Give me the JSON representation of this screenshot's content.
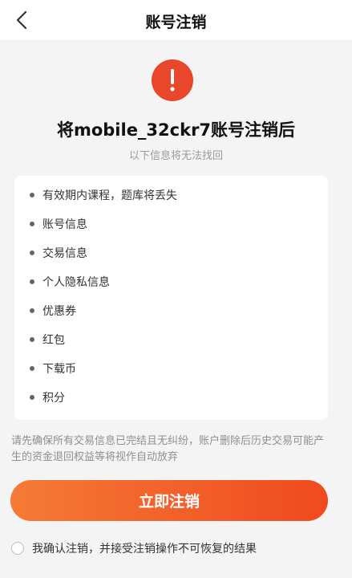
{
  "header": {
    "title": "账号注销",
    "back_icon": "chevron-left-icon"
  },
  "warning": {
    "icon": "exclamation-icon",
    "icon_glyph": "!",
    "color": "#e8472c"
  },
  "main": {
    "title": "将mobile_32ckr7账号注销后",
    "subtitle": "以下信息将无法找回"
  },
  "lost_items": [
    "有效期内课程，题库将丢失",
    "账号信息",
    "交易信息",
    "个人隐私信息",
    "优惠券",
    "红包",
    "下载币",
    "积分"
  ],
  "notice": {
    "text": "请先确保所有交易信息已完结且无纠纷，账户删除后历史交易可能产生的资金退回权益等将视作自动放弃"
  },
  "action": {
    "confirm_button": "立即注销",
    "accent_start": "#f57a36",
    "accent_end": "#ef4a1f"
  },
  "agreement": {
    "text": "我确认注销，并接受注销操作不可恢复的结果",
    "checked": false
  }
}
